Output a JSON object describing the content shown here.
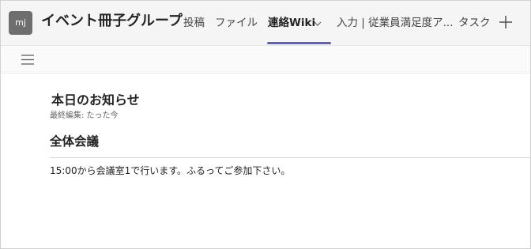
{
  "header": {
    "avatar_initials": "mj",
    "team_name": "イベント冊子グループ",
    "tabs": [
      {
        "label": "投稿"
      },
      {
        "label": "ファイル"
      },
      {
        "label": "連絡Wiki"
      },
      {
        "label": "入力 | 従業員満足度ア..."
      },
      {
        "label": "タスク"
      }
    ],
    "active_tab": "連絡Wiki",
    "add_tab_icon": "plus-icon",
    "dropdown_icon": "chevron-down-icon"
  },
  "toolbar": {
    "menu_icon": "hamburger-menu-icon"
  },
  "wiki": {
    "page_title": "本日のお知らせ",
    "last_edited": "最終編集: たった今",
    "sections": [
      {
        "heading": "全体会議",
        "body": "15:00から会議室1で行います。ふるってご参加下さい。"
      }
    ]
  },
  "colors": {
    "accent": "#5b5fc7",
    "header_bg": "#f5f5f5",
    "avatar_bg": "#6e6e6e"
  }
}
